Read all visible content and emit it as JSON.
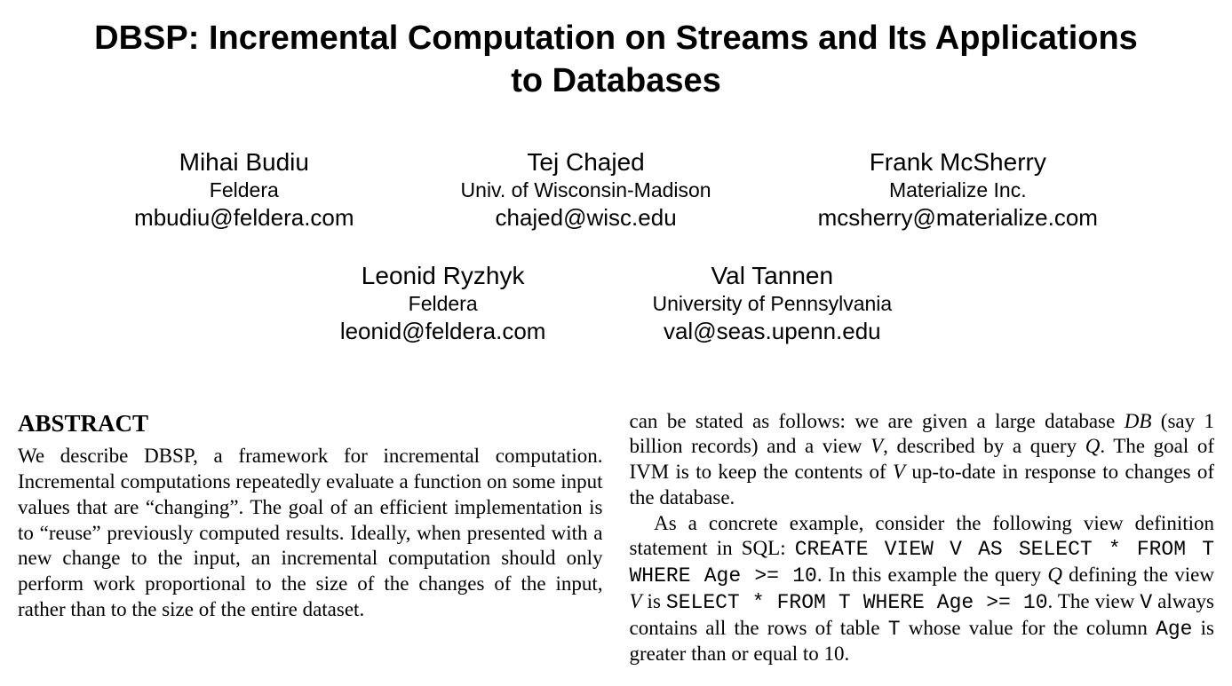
{
  "title": "DBSP: Incremental Computation on Streams and Its Applications to Databases",
  "authors_row1": [
    {
      "name": "Mihai Budiu",
      "affiliation": "Feldera",
      "email": "mbudiu@feldera.com"
    },
    {
      "name": "Tej Chajed",
      "affiliation": "Univ. of Wisconsin-Madison",
      "email": "chajed@wisc.edu"
    },
    {
      "name": "Frank McSherry",
      "affiliation": "Materialize Inc.",
      "email": "mcsherry@materialize.com"
    }
  ],
  "authors_row2": [
    {
      "name": "Leonid Ryzhyk",
      "affiliation": "Feldera",
      "email": "leonid@feldera.com"
    },
    {
      "name": "Val Tannen",
      "affiliation": "University of Pennsylvania",
      "email": "val@seas.upenn.edu"
    }
  ],
  "abstract_heading": "ABSTRACT",
  "abstract_text": "We describe DBSP, a framework for incremental computation. Incremental computations repeatedly evaluate a function on some input values that are “changing”. The goal of an efficient implementation is to “reuse” previously computed results. Ideally, when presented with a new change to the input, an incremental computation should only perform work proportional to the size of the changes of the input, rather than to the size of the entire dataset.",
  "right_col": {
    "p1_a": "can be stated as follows: we are given a large database ",
    "p1_db": "DB",
    "p1_b": " (say 1 billion records) and a view ",
    "p1_v": "V",
    "p1_c": ", described by a query ",
    "p1_q": "Q",
    "p1_d": ". The goal of IVM is to keep the contents of ",
    "p1_v2": "V",
    "p1_e": " up-to-date in response to changes of the database.",
    "p2_a": "As a concrete example, consider the following view definition statement in SQL: ",
    "p2_sql1": "CREATE VIEW V AS SELECT * FROM T WHERE Age >= 10",
    "p2_b": ". In this example the query ",
    "p2_q": "Q",
    "p2_c": " defining the view ",
    "p2_v": "V",
    "p2_d": " is ",
    "p2_sql2": "SELECT * FROM T WHERE Age >= 10",
    "p2_e": ". The view ",
    "p2_vmono": "V",
    "p2_f": " always contains all the rows of table ",
    "p2_tmono": "T",
    "p2_g": " whose value for the column ",
    "p2_age": "Age",
    "p2_h": " is greater than or equal to 10."
  }
}
